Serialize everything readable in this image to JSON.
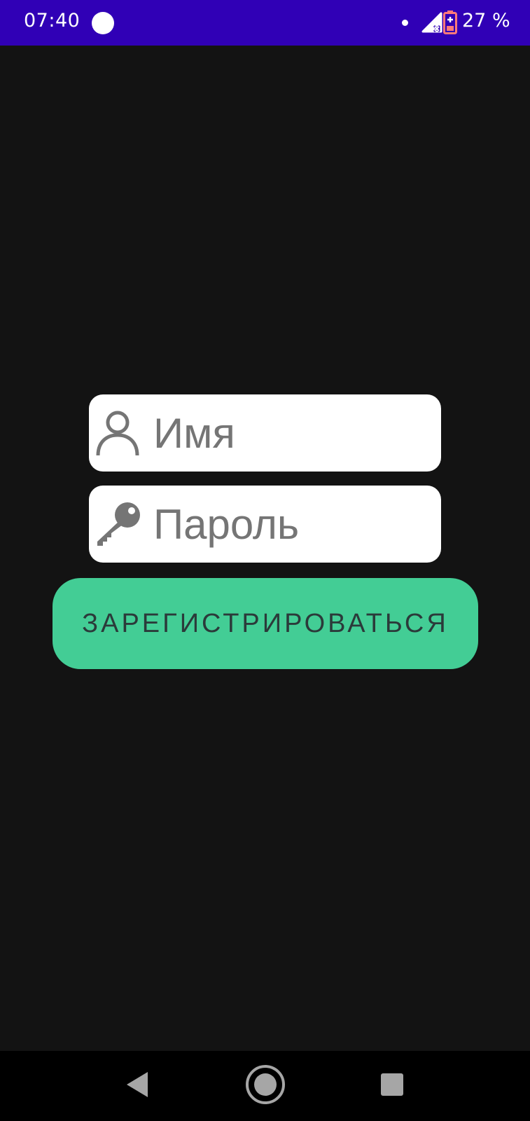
{
  "status_bar": {
    "time": "07:40",
    "battery_text": "27 %",
    "icons": [
      "notification-circle-icon",
      "dot-icon",
      "signal-no-data-icon",
      "battery-low-icon"
    ],
    "background_color": "#3000b6"
  },
  "form": {
    "name_field": {
      "placeholder": "Имя",
      "value": "",
      "icon": "person-icon"
    },
    "password_field": {
      "placeholder": "Пароль",
      "value": "",
      "icon": "key-icon"
    },
    "register_button_label": "ЗАРЕГИСТРИРОВАТЬСЯ",
    "button_color": "#43cd95"
  },
  "nav_bar": {
    "icons": [
      "back-icon",
      "home-icon",
      "recents-icon"
    ]
  },
  "colors": {
    "background": "#131313",
    "field_background": "#ffffff",
    "placeholder": "#757575"
  }
}
